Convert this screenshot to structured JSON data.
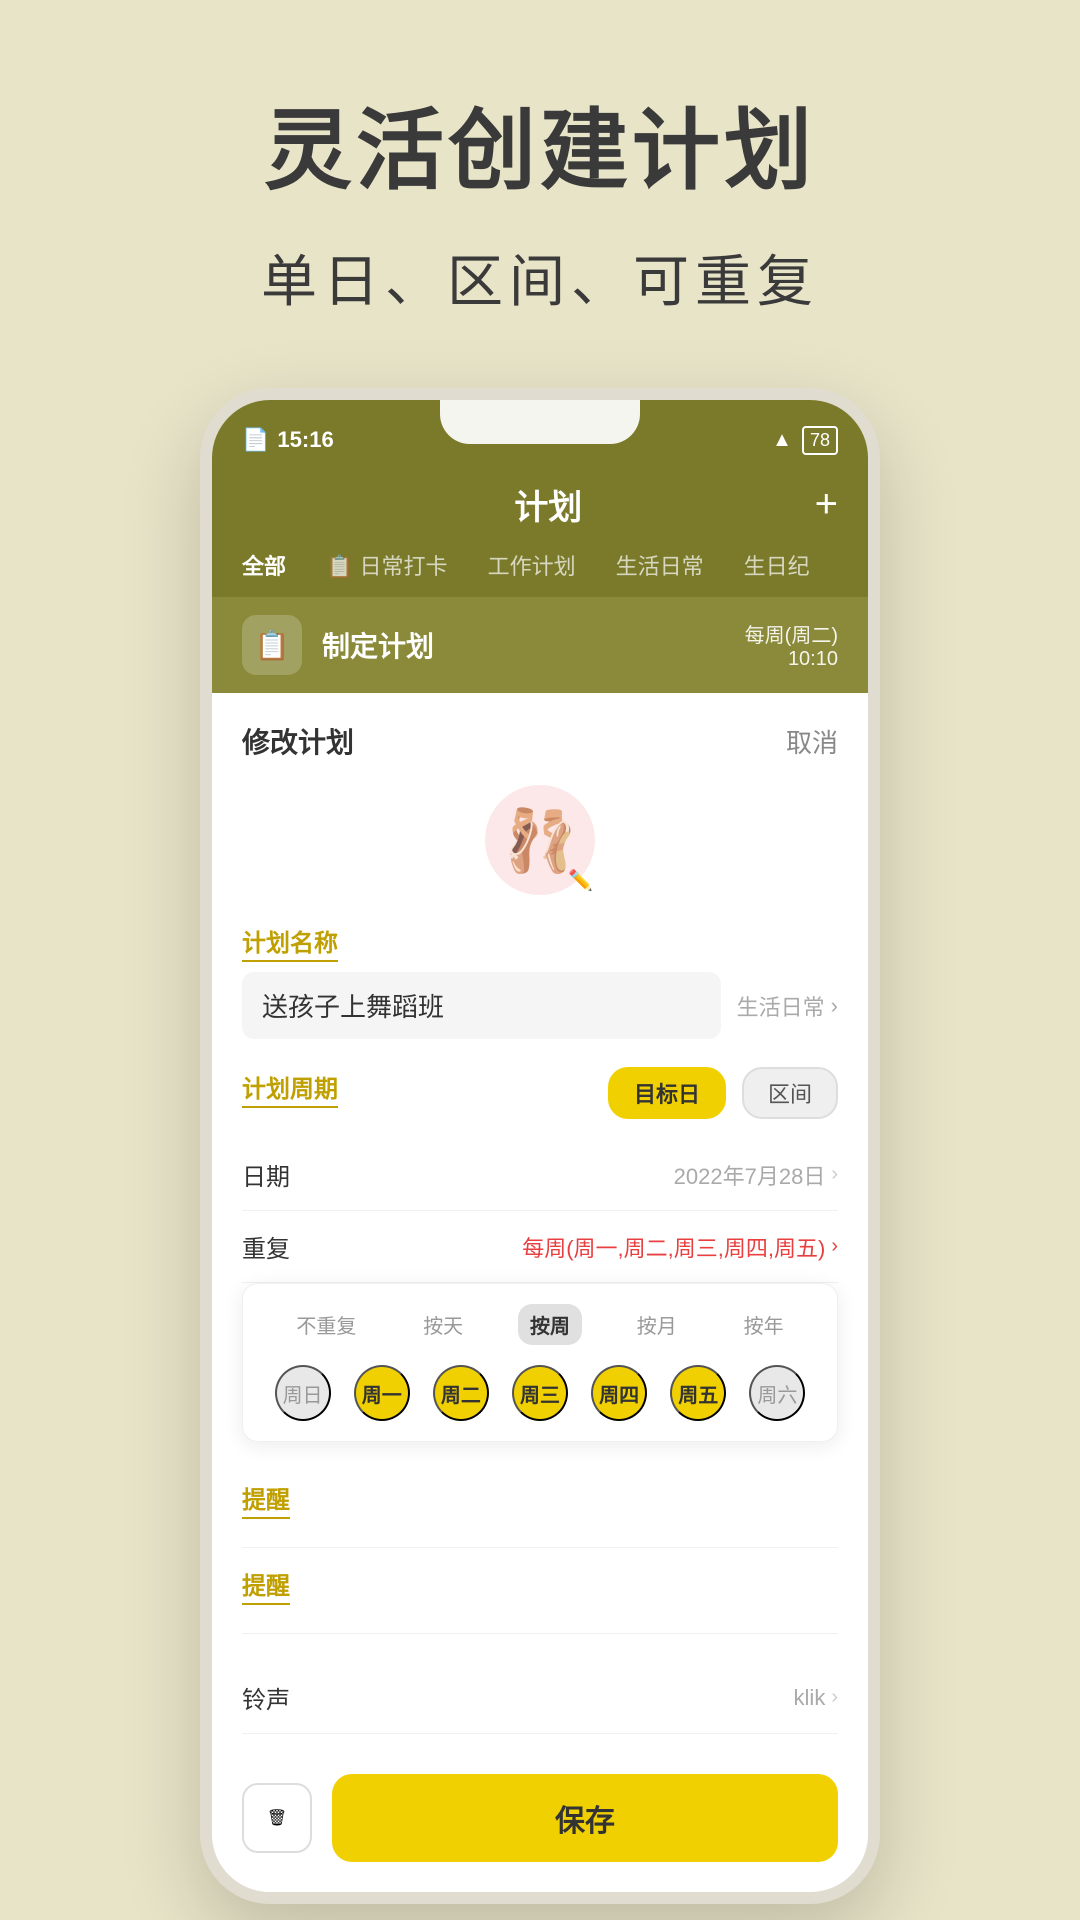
{
  "background_color": "#e8e4c8",
  "headline": {
    "title": "灵活创建计划",
    "subtitle": "单日、区间、可重复"
  },
  "phone": {
    "status_bar": {
      "time": "15:16",
      "battery": "78",
      "wifi": true
    },
    "app_header": {
      "title": "计划",
      "add_button": "+"
    },
    "tabs": [
      {
        "label": "全部",
        "active": true
      },
      {
        "label": "日常打卡",
        "active": false
      },
      {
        "label": "工作计划",
        "active": false
      },
      {
        "label": "生活日常",
        "active": false
      },
      {
        "label": "生日纪",
        "active": false
      }
    ],
    "plan_item": {
      "icon": "📋",
      "name": "制定计划",
      "schedule_line1": "每周(周二)",
      "schedule_line2": "10:10"
    },
    "edit_form": {
      "title": "修改计划",
      "cancel_label": "取消",
      "avatar_emoji": "🩰",
      "field_labels": {
        "plan_name": "计划名称",
        "plan_period": "计划周期",
        "reminder": "提醒",
        "reminder2": "提醒"
      },
      "plan_name_value": "送孩子上舞蹈班",
      "category": "生活日常",
      "period_buttons": [
        {
          "label": "目标日",
          "active": true
        },
        {
          "label": "区间",
          "active": false
        }
      ],
      "date_label": "日期",
      "date_value": "2022年7月28日",
      "repeat_label": "重复",
      "repeat_value": "每周(周一,周二,周三,周四,周五)",
      "repeat_picker": {
        "types": [
          {
            "label": "不重复",
            "active": false
          },
          {
            "label": "按天",
            "active": false
          },
          {
            "label": "按周",
            "active": true
          },
          {
            "label": "按月",
            "active": false
          },
          {
            "label": "按年",
            "active": false
          }
        ],
        "weekdays": [
          {
            "label": "周日",
            "selected": false
          },
          {
            "label": "周一",
            "selected": true
          },
          {
            "label": "周二",
            "selected": true
          },
          {
            "label": "周三",
            "selected": true
          },
          {
            "label": "周四",
            "selected": true
          },
          {
            "label": "周五",
            "selected": true
          },
          {
            "label": "周六",
            "selected": false
          }
        ]
      },
      "ringtone_label": "铃声",
      "ringtone_value": "klik",
      "save_label": "保存",
      "delete_icon": "🗑"
    }
  }
}
